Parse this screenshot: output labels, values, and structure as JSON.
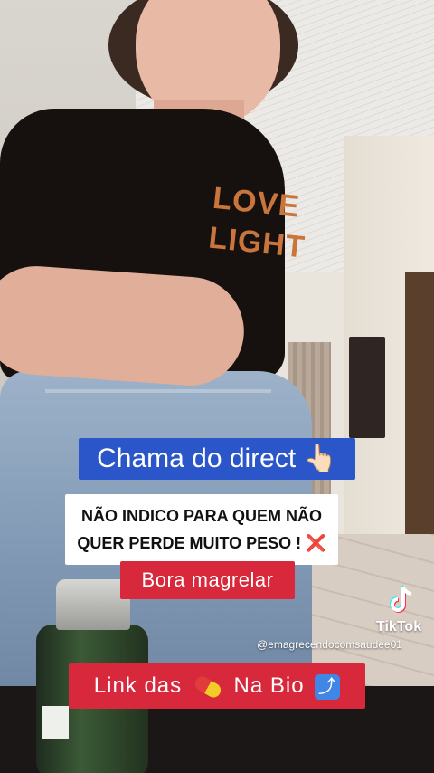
{
  "captions": {
    "direct": "Chama do direct",
    "direct_emoji": "👆🏻",
    "warning_line1": "NÃO INDICO PARA QUEM NÃO",
    "warning_line2": "QUER PERDE MUITO PESO !",
    "warning_emoji": "❌",
    "bora": "Bora magrelar",
    "link_prefix": "Link das",
    "link_suffix": "Na Bio",
    "link_arrow": "⤴"
  },
  "shirt_print": {
    "line1": "LOVE",
    "line2": "LIGHT"
  },
  "watermark": {
    "brand": "TikTok",
    "handle": "@emagrecendocomsaudee01"
  },
  "colors": {
    "caption_blue": "#2b56c9",
    "caption_red": "#d8283b",
    "caption_white": "#ffffff"
  },
  "icons": {
    "tiktok": "tiktok-logo-icon",
    "pill": "pill-icon",
    "arrow": "arrow-up-right-icon",
    "pointing": "pointing-up-icon",
    "cross": "cross-mark-icon"
  }
}
